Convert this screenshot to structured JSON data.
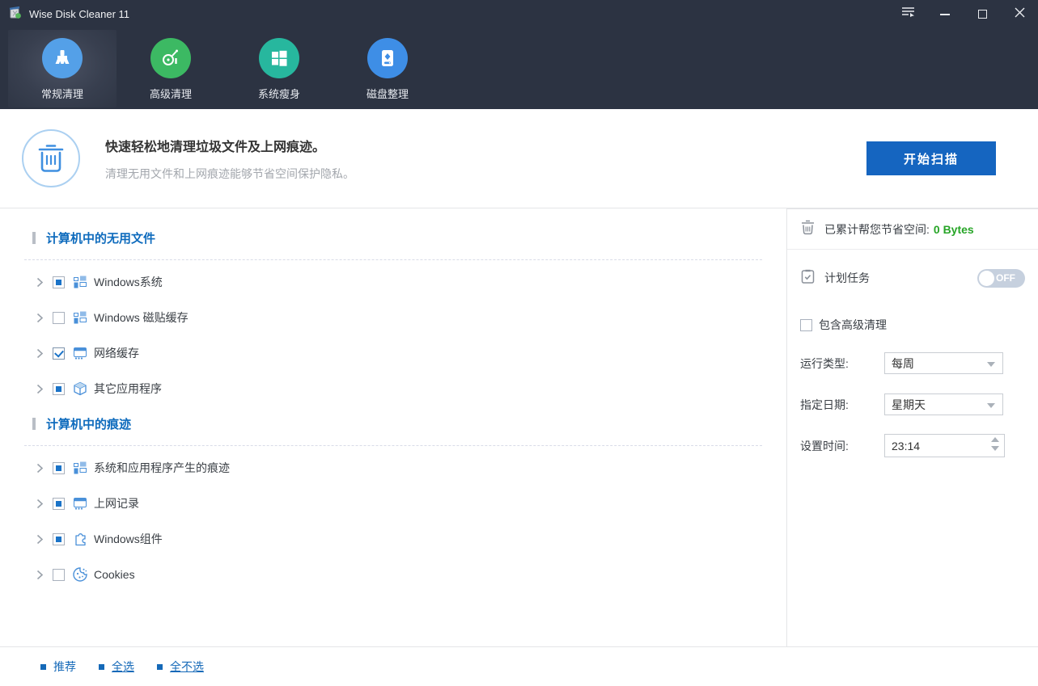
{
  "window": {
    "title": "Wise Disk Cleaner 11"
  },
  "titlebar": {
    "icons": [
      "app-logo-icon",
      "main-menu-icon",
      "minimize-icon",
      "maximize-icon",
      "close-icon"
    ]
  },
  "nav": {
    "tabs": [
      {
        "label": "常规清理",
        "icon": "brush-clean-icon",
        "color": "#54a0e8",
        "active": true
      },
      {
        "label": "高级清理",
        "icon": "vacuum-icon",
        "color": "#3cb963",
        "active": false
      },
      {
        "label": "系统瘦身",
        "icon": "windows-logo-icon",
        "color": "#27b79e",
        "active": false
      },
      {
        "label": "磁盘整理",
        "icon": "disk-icon",
        "color": "#3e8ee6",
        "active": false
      }
    ]
  },
  "header": {
    "title": "快速轻松地清理垃圾文件及上网痕迹。",
    "subtitle": "清理无用文件和上网痕迹能够节省空间保护隐私。",
    "scan_button": "开始扫描",
    "icon": "trash-circle-icon"
  },
  "tree": {
    "sections": [
      {
        "title": "计算机中的无用文件",
        "items": [
          {
            "label": "Windows系统",
            "check": "partial",
            "icon": "tiles-icon"
          },
          {
            "label": "Windows 磁贴缓存",
            "check": "unchecked",
            "icon": "tiles-icon"
          },
          {
            "label": "网络缓存",
            "check": "checked",
            "icon": "browser-icon"
          },
          {
            "label": "其它应用程序",
            "check": "partial",
            "icon": "cube-icon"
          }
        ]
      },
      {
        "title": "计算机中的痕迹",
        "items": [
          {
            "label": "系统和应用程序产生的痕迹",
            "check": "partial",
            "icon": "tiles-icon"
          },
          {
            "label": "上网记录",
            "check": "partial",
            "icon": "browser-icon"
          },
          {
            "label": "Windows组件",
            "check": "partial",
            "icon": "puzzle-icon"
          },
          {
            "label": "Cookies",
            "check": "unchecked",
            "icon": "cookie-icon"
          }
        ]
      }
    ]
  },
  "sidebar": {
    "saved_space_label": "已累计帮您节省空间:",
    "saved_space_value": "0 Bytes",
    "schedule_label": "计划任务",
    "toggle_state": "OFF",
    "include_advanced_label": "包含高级清理",
    "include_advanced_checked": "unchecked",
    "run_type_label": "运行类型:",
    "run_type_value": "每周",
    "day_label": "指定日期:",
    "day_value": "星期天",
    "time_label": "设置时间:",
    "time_value": "23:14"
  },
  "footer": {
    "links": [
      {
        "label": "推荐",
        "underline": false
      },
      {
        "label": "全选",
        "underline": true
      },
      {
        "label": "全不选",
        "underline": true
      }
    ]
  },
  "colors": {
    "titlebar_bg": "#2c3342",
    "accent_blue": "#1565c0",
    "section_blue": "#0e6bbd",
    "saved_green": "#27a527",
    "link_blue": "#1569b8",
    "tree_icon_blue": "#4a90d9",
    "toggle_off_bg": "#c6d0de"
  }
}
